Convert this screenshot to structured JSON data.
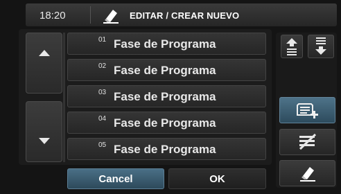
{
  "header": {
    "time": "18:20",
    "title": "EDITAR / CREAR NUEVO",
    "title_icon": "eraser-pencil-icon"
  },
  "list": {
    "rows": [
      {
        "num": "01",
        "label": "Fase de Programa"
      },
      {
        "num": "02",
        "label": "Fase de Programa"
      },
      {
        "num": "03",
        "label": "Fase de Programa"
      },
      {
        "num": "04",
        "label": "Fase de Programa"
      },
      {
        "num": "05",
        "label": "Fase de Programa"
      }
    ]
  },
  "buttons": {
    "cancel": "Cancel",
    "ok": "OK"
  },
  "side_icons": {
    "move_up": "move-up-icon",
    "move_down": "move-down-icon",
    "new": "new-item-icon",
    "delete": "delete-icon",
    "edit": "edit-icon"
  },
  "colors": {
    "accent": "#3f6378",
    "background": "#141414",
    "row": "#2e2e2e",
    "text": "#e8e8e8"
  }
}
